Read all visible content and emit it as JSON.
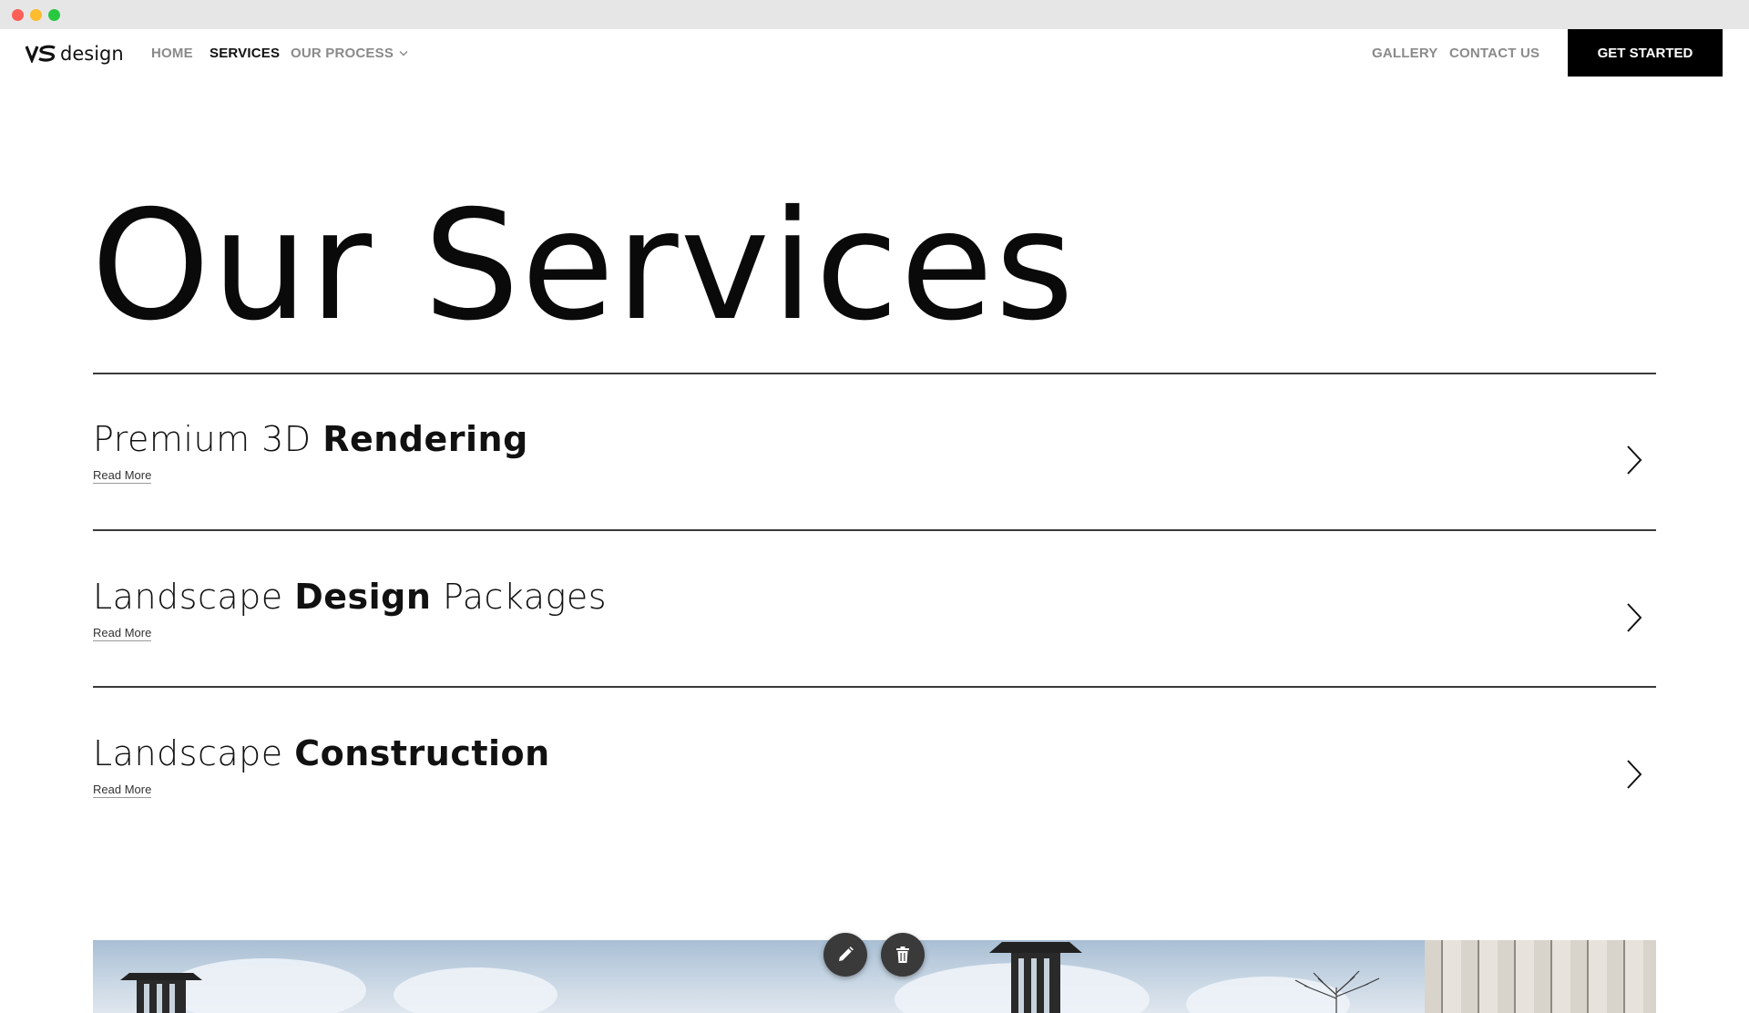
{
  "window": {
    "controls": [
      "close",
      "minimize",
      "zoom"
    ]
  },
  "header": {
    "logo": {
      "text": "design",
      "icon": "vs-logo-icon"
    },
    "nav": {
      "home": "HOME",
      "services": "SERVICES",
      "our_process": "OUR PROCESS",
      "gallery": "GALLERY",
      "contact": "CONTACT US"
    },
    "active_nav": "SERVICES",
    "cta_label": "GET STARTED"
  },
  "main": {
    "title": "Our Services",
    "services": [
      {
        "title_parts": [
          {
            "text": "Premium 3D ",
            "bold": false
          },
          {
            "text": "Rendering",
            "bold": true
          }
        ],
        "read_more": "Read More"
      },
      {
        "title_parts": [
          {
            "text": "Landscape ",
            "bold": false
          },
          {
            "text": "Design",
            "bold": true
          },
          {
            "text": " Packages",
            "bold": false
          }
        ],
        "read_more": "Read More"
      },
      {
        "title_parts": [
          {
            "text": "Landscape ",
            "bold": false
          },
          {
            "text": "Construction",
            "bold": true
          }
        ],
        "read_more": "Read More"
      }
    ]
  },
  "editor_controls": {
    "edit_icon": "pencil-icon",
    "delete_icon": "trash-icon"
  },
  "colors": {
    "cta_background": "#000000",
    "nav_inactive": "#8a8a8a",
    "nav_active": "#111111",
    "divider": "#3a3a3a",
    "fab": "#3a3a3a"
  }
}
